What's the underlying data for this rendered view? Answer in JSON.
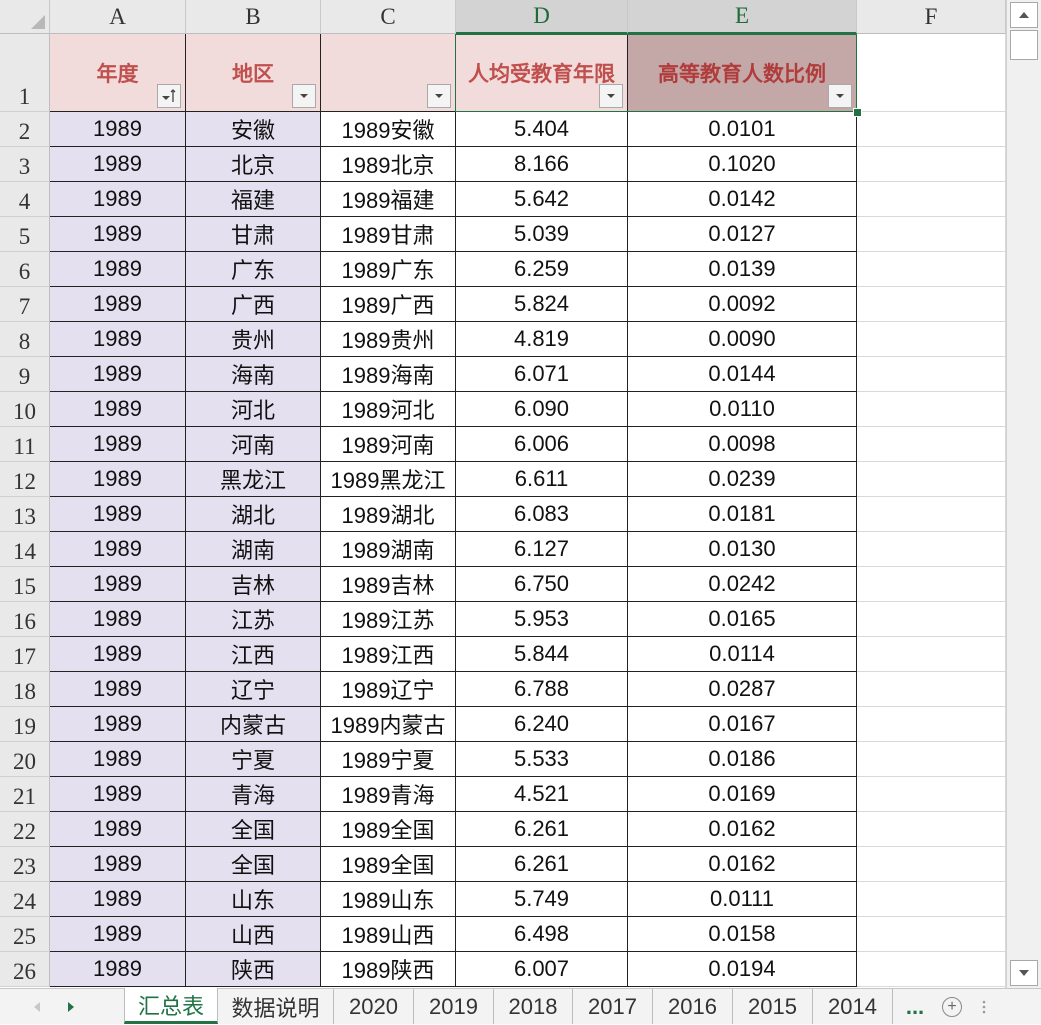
{
  "columns": [
    "A",
    "B",
    "C",
    "D",
    "E",
    "F"
  ],
  "headers": {
    "year": "年度",
    "region": "地区",
    "combo": "",
    "avg_edu_years": "人均受教育年限",
    "higher_edu_ratio": "高等教育人数比例"
  },
  "header_row_number": "1",
  "rows": [
    {
      "n": "2",
      "year": "1989",
      "region": "安徽",
      "combo": "1989安徽",
      "d": "5.404",
      "e": "0.0101"
    },
    {
      "n": "3",
      "year": "1989",
      "region": "北京",
      "combo": "1989北京",
      "d": "8.166",
      "e": "0.1020"
    },
    {
      "n": "4",
      "year": "1989",
      "region": "福建",
      "combo": "1989福建",
      "d": "5.642",
      "e": "0.0142"
    },
    {
      "n": "5",
      "year": "1989",
      "region": "甘肃",
      "combo": "1989甘肃",
      "d": "5.039",
      "e": "0.0127"
    },
    {
      "n": "6",
      "year": "1989",
      "region": "广东",
      "combo": "1989广东",
      "d": "6.259",
      "e": "0.0139"
    },
    {
      "n": "7",
      "year": "1989",
      "region": "广西",
      "combo": "1989广西",
      "d": "5.824",
      "e": "0.0092"
    },
    {
      "n": "8",
      "year": "1989",
      "region": "贵州",
      "combo": "1989贵州",
      "d": "4.819",
      "e": "0.0090"
    },
    {
      "n": "9",
      "year": "1989",
      "region": "海南",
      "combo": "1989海南",
      "d": "6.071",
      "e": "0.0144"
    },
    {
      "n": "10",
      "year": "1989",
      "region": "河北",
      "combo": "1989河北",
      "d": "6.090",
      "e": "0.0110"
    },
    {
      "n": "11",
      "year": "1989",
      "region": "河南",
      "combo": "1989河南",
      "d": "6.006",
      "e": "0.0098"
    },
    {
      "n": "12",
      "year": "1989",
      "region": "黑龙江",
      "combo": "1989黑龙江",
      "d": "6.611",
      "e": "0.0239"
    },
    {
      "n": "13",
      "year": "1989",
      "region": "湖北",
      "combo": "1989湖北",
      "d": "6.083",
      "e": "0.0181"
    },
    {
      "n": "14",
      "year": "1989",
      "region": "湖南",
      "combo": "1989湖南",
      "d": "6.127",
      "e": "0.0130"
    },
    {
      "n": "15",
      "year": "1989",
      "region": "吉林",
      "combo": "1989吉林",
      "d": "6.750",
      "e": "0.0242"
    },
    {
      "n": "16",
      "year": "1989",
      "region": "江苏",
      "combo": "1989江苏",
      "d": "5.953",
      "e": "0.0165"
    },
    {
      "n": "17",
      "year": "1989",
      "region": "江西",
      "combo": "1989江西",
      "d": "5.844",
      "e": "0.0114"
    },
    {
      "n": "18",
      "year": "1989",
      "region": "辽宁",
      "combo": "1989辽宁",
      "d": "6.788",
      "e": "0.0287"
    },
    {
      "n": "19",
      "year": "1989",
      "region": "内蒙古",
      "combo": "1989内蒙古",
      "d": "6.240",
      "e": "0.0167"
    },
    {
      "n": "20",
      "year": "1989",
      "region": "宁夏",
      "combo": "1989宁夏",
      "d": "5.533",
      "e": "0.0186"
    },
    {
      "n": "21",
      "year": "1989",
      "region": "青海",
      "combo": "1989青海",
      "d": "4.521",
      "e": "0.0169"
    },
    {
      "n": "22",
      "year": "1989",
      "region": "全国",
      "combo": "1989全国",
      "d": "6.261",
      "e": "0.0162"
    },
    {
      "n": "23",
      "year": "1989",
      "region": "全国",
      "combo": "1989全国",
      "d": "6.261",
      "e": "0.0162"
    },
    {
      "n": "24",
      "year": "1989",
      "region": "山东",
      "combo": "1989山东",
      "d": "5.749",
      "e": "0.0111"
    },
    {
      "n": "25",
      "year": "1989",
      "region": "山西",
      "combo": "1989山西",
      "d": "6.498",
      "e": "0.0158"
    },
    {
      "n": "26",
      "year": "1989",
      "region": "陕西",
      "combo": "1989陕西",
      "d": "6.007",
      "e": "0.0194"
    }
  ],
  "sheet_tabs": [
    "汇总表",
    "数据说明",
    "2020",
    "2019",
    "2018",
    "2017",
    "2016",
    "2015",
    "2014"
  ],
  "active_tab": "汇总表",
  "more_tabs": "...",
  "add_sheet": "+",
  "colors": {
    "header_fill": "#f2dcdb",
    "header_text": "#c0504d",
    "selected_header_fill": "#c4a7a7",
    "data_fill_ab": "#e4e0f0",
    "accent": "#217346"
  }
}
